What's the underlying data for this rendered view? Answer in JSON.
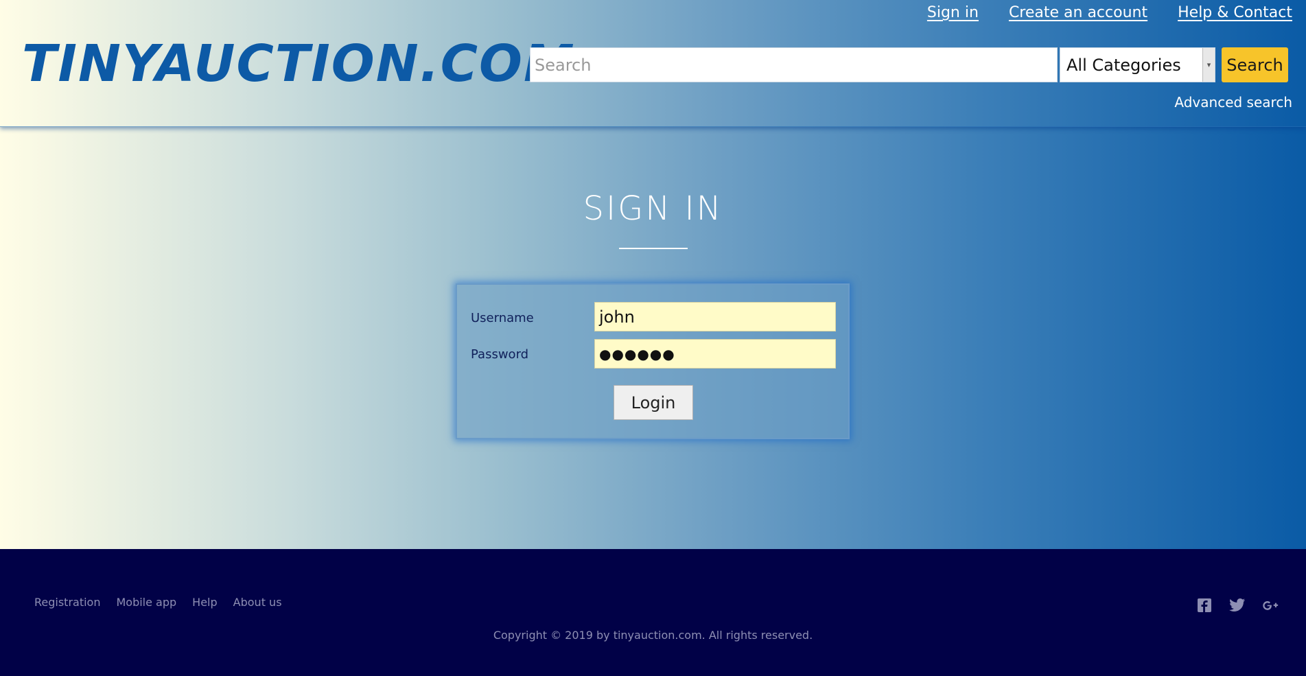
{
  "header": {
    "links": [
      "Sign in",
      "Create an account",
      "Help & Contact"
    ],
    "logo": "TINYAUCTION.COM",
    "search": {
      "placeholder": "Search",
      "value": "",
      "category": "All Categories",
      "button": "Search",
      "advanced": "Advanced search"
    }
  },
  "main": {
    "title": "SIGN IN",
    "form": {
      "username_label": "Username",
      "username_value": "john",
      "password_label": "Password",
      "password_mask": "●●●●●●",
      "login_button": "Login"
    }
  },
  "footer": {
    "links": [
      "Registration",
      "Mobile app",
      "Help",
      "About us"
    ],
    "copyright": "Copyright © 2019 by tinyauction.com. All rights reserved.",
    "social": [
      "facebook-icon",
      "twitter-icon",
      "google-plus-icon"
    ]
  },
  "colors": {
    "logo": "#0d5aa6",
    "search_button": "#f7c42a",
    "input_bg": "#fffbc8",
    "footer_bg": "#010147"
  }
}
